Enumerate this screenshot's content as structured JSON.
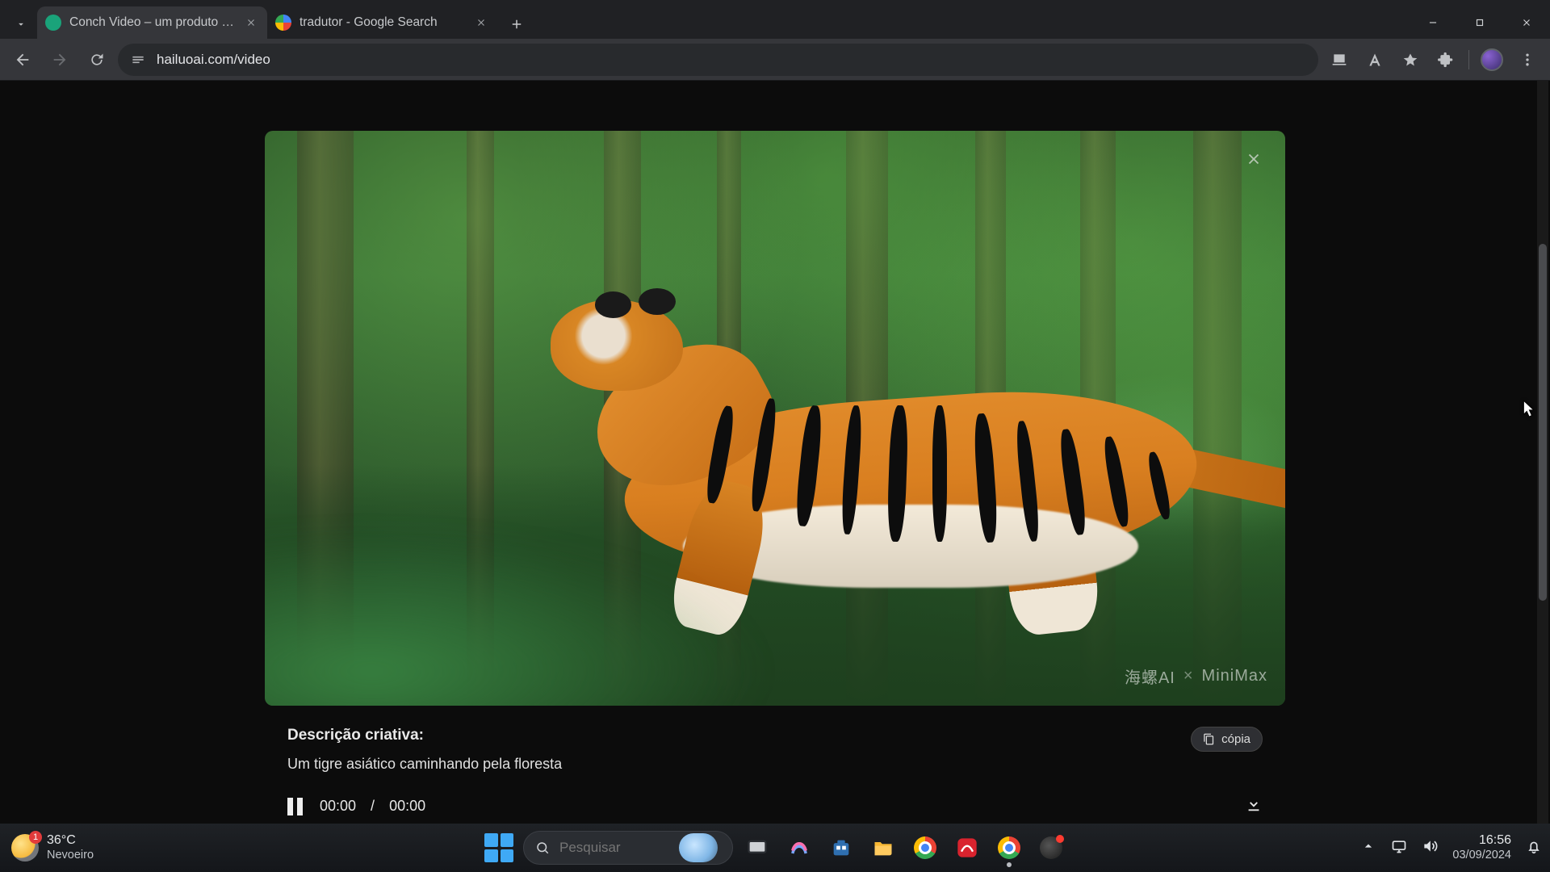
{
  "browser": {
    "tabs": [
      {
        "title": "Conch Video – um produto da",
        "active": true,
        "favicon_color": "#1aa37a"
      },
      {
        "title": "tradutor - Google Search",
        "active": false,
        "favicon_color": "#ffffff"
      }
    ],
    "url": "hailuoai.com/video"
  },
  "modal": {
    "watermark_left": "海螺AI",
    "watermark_x": "×",
    "watermark_right": "MiniMax",
    "description_heading": "Descrição criativa:",
    "description_text": "Um tigre asiático caminhando pela floresta",
    "copy_label": "cópia",
    "time_current": "00:00",
    "time_sep": "/",
    "time_total": "00:00"
  },
  "taskbar": {
    "weather_temp": "36°C",
    "weather_desc": "Nevoeiro",
    "search_placeholder": "Pesquisar",
    "time": "16:56",
    "date": "03/09/2024"
  }
}
